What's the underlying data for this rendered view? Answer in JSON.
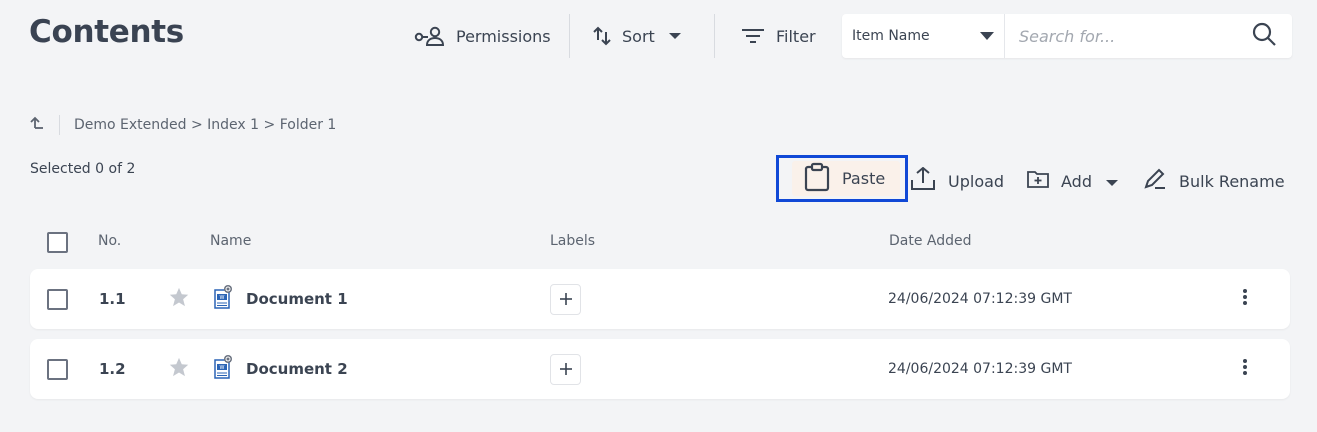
{
  "header": {
    "title": "Contents",
    "permissions_label": "Permissions",
    "sort_label": "Sort",
    "filter_label": "Filter",
    "search_field_select": "Item Name",
    "search_placeholder": "Search for..."
  },
  "breadcrumb": {
    "path": "Demo Extended > Index 1 > Folder 1"
  },
  "selection": {
    "text": "Selected 0 of 2"
  },
  "actions": {
    "paste_label": "Paste",
    "upload_label": "Upload",
    "add_label": "Add",
    "bulk_rename_label": "Bulk Rename"
  },
  "table": {
    "columns": [
      "No.",
      "Name",
      "Labels",
      "Date Added"
    ],
    "rows": [
      {
        "no": "1.1",
        "name": "Document 1",
        "date_added": "24/06/2024 07:12:39 GMT"
      },
      {
        "no": "1.2",
        "name": "Document 2",
        "date_added": "24/06/2024 07:12:39 GMT"
      }
    ]
  },
  "colors": {
    "highlight_border": "#1048d6",
    "paste_background": "#faf1ea",
    "word_icon": "#2b64b5"
  },
  "icons": [
    "permissions-icon",
    "sort-icon",
    "chevron-down-icon",
    "filter-icon",
    "search-icon",
    "back-arrow-icon",
    "clipboard-icon",
    "upload-icon",
    "folder-add-icon",
    "rename-icon",
    "star-icon",
    "word-document-icon",
    "plus-icon",
    "more-vertical-icon"
  ]
}
